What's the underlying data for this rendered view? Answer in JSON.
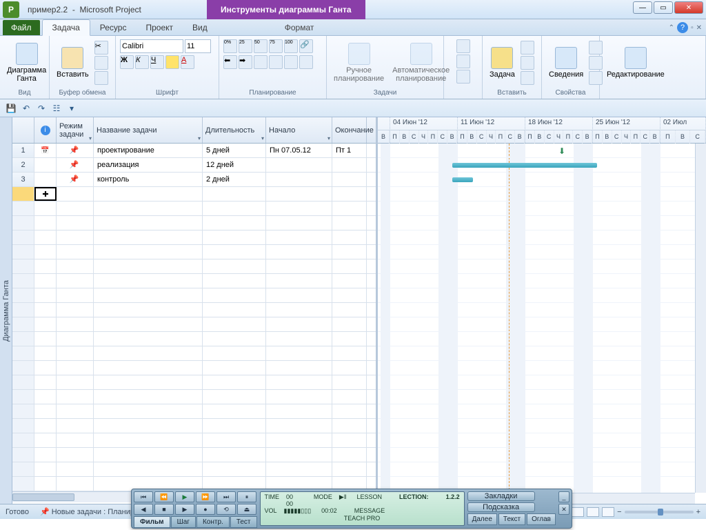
{
  "title_bar": {
    "doc": "пример2.2",
    "app": "Microsoft Project",
    "contextual_group": "Инструменты диаграммы Ганта"
  },
  "tabs": {
    "file": "Файл",
    "task": "Задача",
    "resource": "Ресурс",
    "project": "Проект",
    "view": "Вид",
    "format": "Формат"
  },
  "ribbon": {
    "view": {
      "gantt": "Диаграмма\nГанта",
      "label": "Вид"
    },
    "clipboard": {
      "paste": "Вставить",
      "label": "Буфер обмена"
    },
    "font": {
      "family": "Calibri",
      "size": "11",
      "bold": "Ж",
      "italic": "К",
      "underline": "Ч",
      "label": "Шрифт"
    },
    "schedule": {
      "label": "Планирование"
    },
    "tasks": {
      "manual": "Ручное\nпланирование",
      "auto": "Автоматическое\nпланирование",
      "label": "Задачи"
    },
    "insert": {
      "task": "Задача",
      "label": "Вставить"
    },
    "props": {
      "info": "Сведения",
      "label": "Свойства"
    },
    "edit": {
      "label": "Редактирование"
    }
  },
  "columns": {
    "mode": "Режим\nзадачи",
    "name": "Название задачи",
    "duration": "Длительность",
    "start": "Начало",
    "finish": "Окончание"
  },
  "rows": [
    {
      "n": "1",
      "name": "проектирование",
      "dur": "5 дней",
      "start": "Пн 07.05.12",
      "finish": "Пт 1"
    },
    {
      "n": "2",
      "name": "реализация",
      "dur": "12 дней",
      "start": "",
      "finish": ""
    },
    {
      "n": "3",
      "name": "контроль",
      "dur": "2 дней",
      "start": "",
      "finish": ""
    }
  ],
  "timeline": {
    "weeks": [
      "04 Июн '12",
      "11 Июн '12",
      "18 Июн '12",
      "25 Июн '12",
      "02 Июл"
    ],
    "days": [
      "В",
      "П",
      "В",
      "С",
      "Ч",
      "П",
      "С"
    ]
  },
  "sidebar": {
    "label": "Диаграмма Ганта"
  },
  "status": {
    "ready": "Готово",
    "new_tasks": "Новые задачи : Планирование вручную"
  },
  "player": {
    "tabs": {
      "film": "Фильм",
      "step": "Шаг",
      "kontr": "Контр.",
      "test": "Тест"
    },
    "lcd": {
      "time_lbl": "TIME",
      "time": "00 00",
      "mode_lbl": "MODE",
      "lesson_lbl": "LESSON",
      "lection_lbl": "LECTION:",
      "lection": "1.2.2",
      "vol_lbl": "VOL",
      "msg_lbl": "MESSAGE",
      "clock": "00:02",
      "brand": "TEACH PRO"
    },
    "side": {
      "bookmarks": "Закладки",
      "hint": "Подсказка"
    },
    "nav": {
      "next": "Далее",
      "text": "Текст",
      "toc": "Оглав"
    }
  }
}
